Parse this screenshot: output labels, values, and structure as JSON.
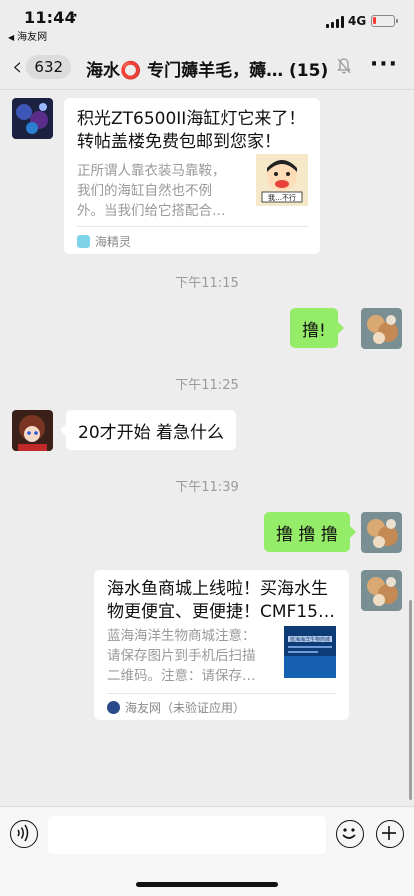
{
  "status_bar": {
    "time": "11:44",
    "location_icon": "location-arrow-icon",
    "back_app": "海友网",
    "network": "4G",
    "battery_level": 0.15,
    "colors": {
      "battery_low": "#ff3b30"
    }
  },
  "nav": {
    "back_icon": "chevron-left-icon",
    "unread_count": "632",
    "title": "海水⭕ 专门薅羊毛，薅…",
    "member_count": "(15)",
    "mute_icon": "bell-slash-icon",
    "more_icon": "more-dots-icon"
  },
  "messages": [
    {
      "type": "link-card",
      "direction": "incoming",
      "title_line1": "积光ZT6500II海缸灯它来了！",
      "title_line2": "转帖盖楼免费包邮到您家！",
      "desc_line1": "正所谓人靠衣装马靠鞍，",
      "desc_line2": "我们的海缸自然也不例",
      "desc_line3": "外。当我们给它搭配合…",
      "source": "海精灵",
      "thumb_caption": "我…不行"
    },
    {
      "type": "time",
      "text": "下午11:15"
    },
    {
      "type": "text",
      "direction": "outgoing",
      "text": "撸!"
    },
    {
      "type": "time",
      "text": "下午11:25"
    },
    {
      "type": "text",
      "direction": "incoming",
      "text": "20才开始   着急什么"
    },
    {
      "type": "time",
      "text": "下午11:39"
    },
    {
      "type": "text",
      "direction": "outgoing",
      "text": "撸 撸 撸"
    },
    {
      "type": "link-card",
      "direction": "outgoing",
      "title_line1": "海水鱼商城上线啦！买海水生",
      "title_line2": "物更便宜、更便捷！CMF15…",
      "desc_line1": "蓝海海洋生物商城注意：",
      "desc_line2": "请保存图片到手机后扫描",
      "desc_line3": "二维码。注意：请保存…",
      "source": "海友网（未验证应用）",
      "thumb_caption": "蓝海海洋生物商城"
    }
  ],
  "input_bar": {
    "voice_icon": "voice-icon",
    "emoji_icon": "emoji-icon",
    "plus_icon": "plus-icon",
    "placeholder": ""
  },
  "colors": {
    "background": "#ededed",
    "outgoing_bubble": "#95ec69",
    "incoming_bubble": "#ffffff",
    "time_text": "#9b9b9b"
  }
}
